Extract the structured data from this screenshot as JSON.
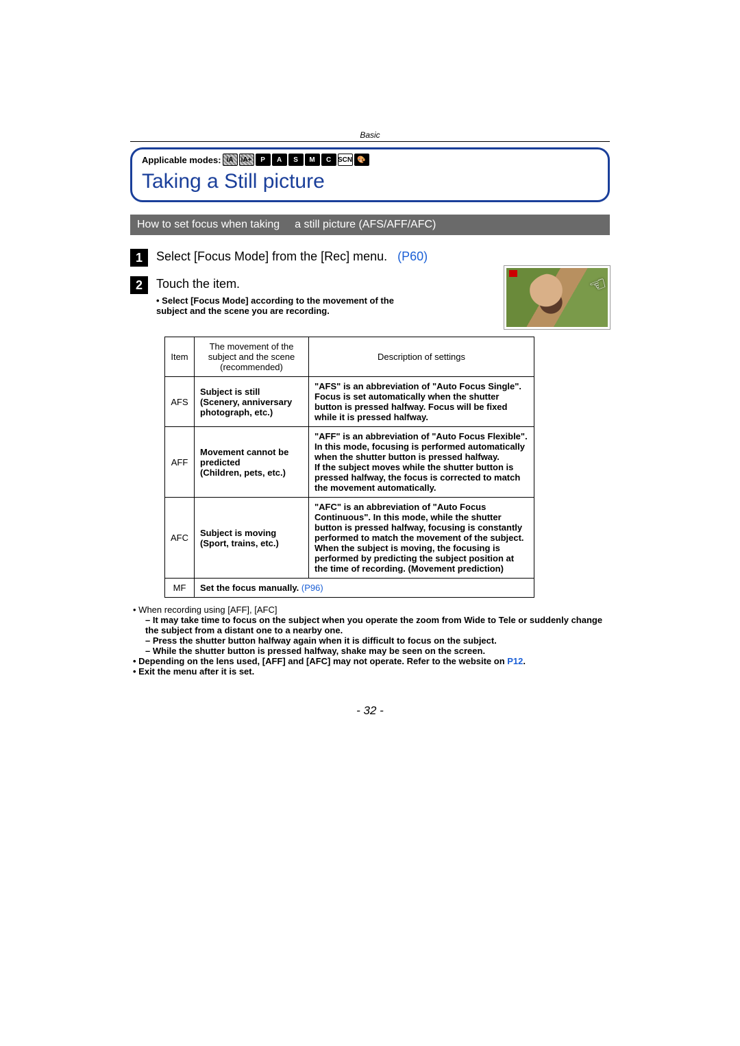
{
  "header": {
    "category": "Basic",
    "applicable_label": "Applicable modes:",
    "mode_icons": [
      "iA",
      "iA+",
      "P",
      "A",
      "S",
      "M",
      "C",
      "SCN",
      "🎨"
    ]
  },
  "title": "Taking a Still picture",
  "section_bar": {
    "left": "How to set focus when taking",
    "right": "a still picture (AFS/AFF/AFC)"
  },
  "steps": [
    {
      "num": "1",
      "text": "Select [Focus Mode] from the [Rec] menu.",
      "ref": "(P60)"
    },
    {
      "num": "2",
      "text": "Touch the item.",
      "note": "• Select [Focus Mode] according to the movement of the subject and the scene you are recording."
    }
  ],
  "table": {
    "headers": [
      "Item",
      "The movement of the subject and the scene (recommended)",
      "Description of settings"
    ],
    "rows": [
      {
        "item": "AFS",
        "movement": "Subject is still\n(Scenery, anniversary photograph, etc.)",
        "desc": "\"AFS\" is an abbreviation of \"Auto Focus Single\". Focus is set automatically when the shutter button is pressed halfway. Focus will be fixed while it is pressed halfway."
      },
      {
        "item": "AFF",
        "movement": "Movement cannot be predicted\n(Children, pets, etc.)",
        "desc": "\"AFF\" is an abbreviation of \"Auto Focus Flexible\". In this mode, focusing is performed automatically when the shutter button is pressed halfway.\nIf the subject moves while the shutter button is pressed halfway, the focus is corrected to match the movement automatically."
      },
      {
        "item": "AFC",
        "movement": "Subject is moving\n(Sport, trains, etc.)",
        "desc": "\"AFC\" is an abbreviation of \"Auto Focus Continuous\". In this mode, while the shutter button is pressed halfway, focusing is constantly performed to match the movement of the subject. When the subject is moving, the focusing is performed by predicting the subject position at the time of recording. (Movement prediction)"
      },
      {
        "item": "MF",
        "movement_plain": "Set the focus manually.",
        "movement_ref": "(P96)",
        "desc": ""
      }
    ]
  },
  "notes": {
    "intro": "When recording using [AFF], [AFC]",
    "sub": [
      "It may take time to focus on the subject when you operate the zoom from Wide to Tele or suddenly change the subject from a distant one to a nearby one.",
      "Press the shutter button halfway again when it is difficult to focus on the subject.",
      "While the shutter button is pressed halfway, shake may be seen on the screen."
    ],
    "bullet2_pre": "Depending on the lens used, [AFF] and [AFC] may not operate. Refer to the website on ",
    "bullet2_ref": "P12",
    "bullet2_post": ".",
    "bullet3": "Exit the menu after it is set."
  },
  "page_number": "- 32 -"
}
